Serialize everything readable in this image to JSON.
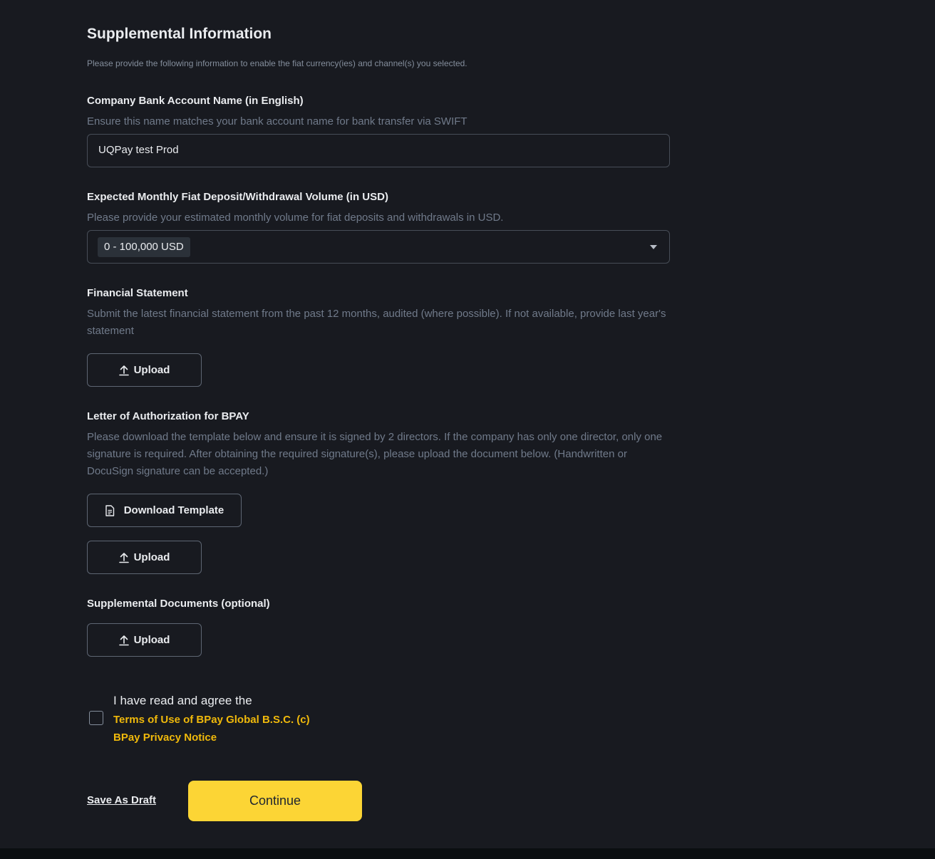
{
  "header": {
    "title": "Supplemental Information",
    "subtitle": "Please provide the following information to enable the fiat currency(ies) and channel(s) you selected."
  },
  "bank_account": {
    "label": "Company Bank Account Name (in English)",
    "hint": "Ensure this name matches your bank account name for bank transfer via SWIFT",
    "value": "UQPay test Prod"
  },
  "volume": {
    "label": "Expected Monthly Fiat Deposit/Withdrawal Volume (in USD)",
    "hint": "Please provide your estimated monthly volume for fiat deposits and withdrawals in USD.",
    "selected": "0 - 100,000 USD"
  },
  "financial_statement": {
    "label": "Financial Statement",
    "hint": "Submit the latest financial statement from the past 12 months, audited (where possible). If not available, provide last year's statement",
    "upload_label": "Upload"
  },
  "authorization_letter": {
    "label": "Letter of Authorization for BPAY",
    "hint": "Please download the template below and ensure it is signed by 2 directors. If the company has only one director, only one signature is required. After obtaining the required signature(s), please upload the document below. (Handwritten or DocuSign signature can be accepted.)",
    "download_label": "Download Template",
    "upload_label": "Upload"
  },
  "supplemental_documents": {
    "label": "Supplemental Documents (optional)",
    "upload_label": "Upload"
  },
  "agreement": {
    "text": "I have read and agree the",
    "terms_link": "Terms of Use of BPay Global B.S.C. (c)",
    "privacy_link": "BPay Privacy Notice",
    "checked": false
  },
  "actions": {
    "save_draft": "Save As Draft",
    "continue": "Continue"
  },
  "colors": {
    "background": "#181a20",
    "accent": "#fcd535",
    "link": "#f0b90b"
  },
  "icons": {
    "upload": "upload-icon",
    "document": "document-icon",
    "dropdown": "caret-down-icon"
  }
}
